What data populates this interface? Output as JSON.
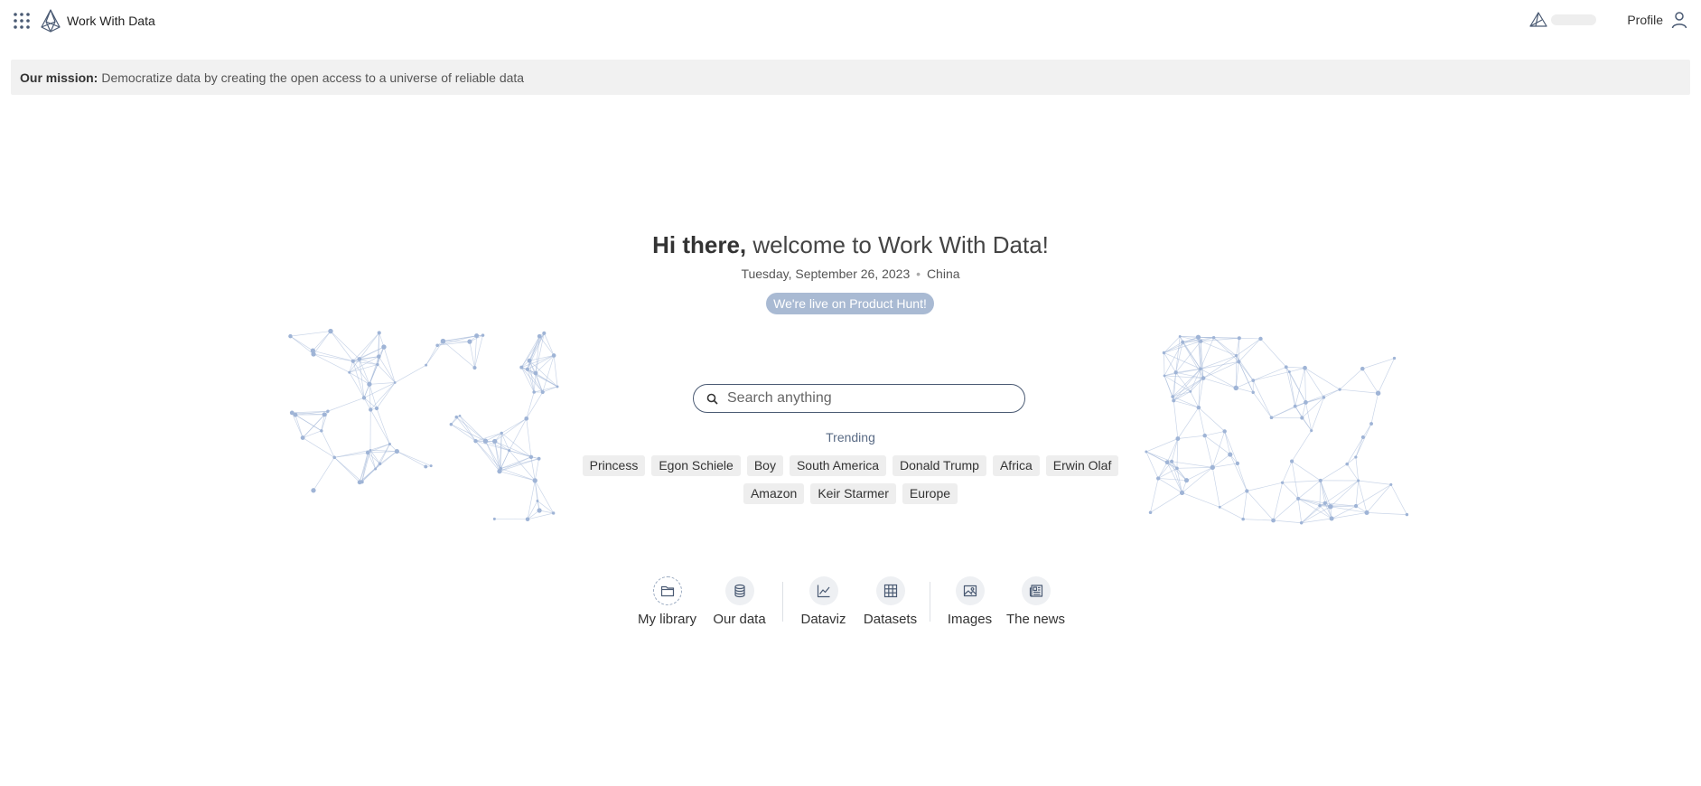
{
  "header": {
    "brand_name": "Work With Data",
    "profile_label": "Profile"
  },
  "mission": {
    "label": "Our mission:",
    "text": "Democratize data by creating the open access to a universe of reliable data"
  },
  "hero": {
    "greeting": "Hi there,",
    "welcome": "welcome to Work With Data!",
    "date": "Tuesday, September 26, 2023",
    "separator": "•",
    "location": "China",
    "badge": "We're live on Product Hunt!"
  },
  "search": {
    "placeholder": "Search anything",
    "value": ""
  },
  "trending": {
    "label": "Trending",
    "tags": [
      "Princess",
      "Egon Schiele",
      "Boy",
      "South America",
      "Donald Trump",
      "Africa",
      "Erwin Olaf",
      "Amazon",
      "Keir Starmer",
      "Europe"
    ]
  },
  "nav": {
    "items": [
      {
        "label": "My library",
        "icon": "folder-icon"
      },
      {
        "label": "Our data",
        "icon": "database-icon"
      },
      {
        "label": "Dataviz",
        "icon": "line-chart-icon"
      },
      {
        "label": "Datasets",
        "icon": "grid-icon"
      },
      {
        "label": "Images",
        "icon": "image-icon"
      },
      {
        "label": "The news",
        "icon": "newspaper-icon"
      }
    ]
  },
  "colors": {
    "accent": "#4a5a73",
    "badge": "#a9bad3",
    "mission_bg": "#f1f1f1",
    "tag_bg": "#eeeeee",
    "network": "#9fb4d6"
  }
}
